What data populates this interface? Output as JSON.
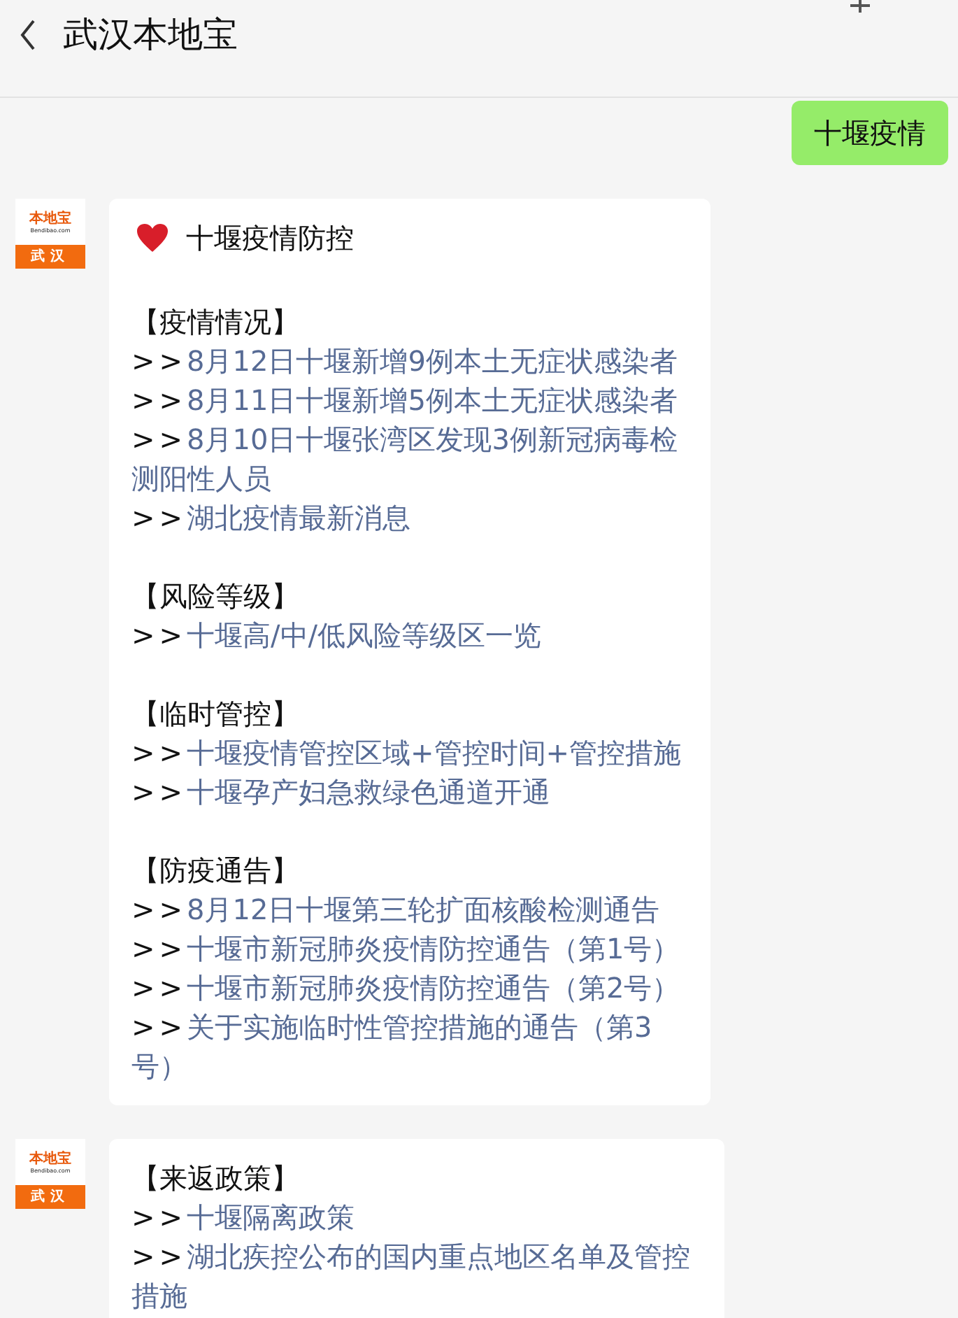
{
  "header": {
    "title": "武汉本地宝"
  },
  "messages": [
    {
      "kind": "sent",
      "text": "十堰疫情"
    },
    {
      "kind": "received",
      "avatar": {
        "brand": "本地宝",
        "site": "Bendibao.com",
        "city": "武汉"
      },
      "lines": [
        {
          "kind": "title",
          "text": "十堰疫情防控"
        },
        {
          "kind": "blank"
        },
        {
          "kind": "heading",
          "text": "【疫情情况】"
        },
        {
          "kind": "link",
          "prefix": ">>",
          "text": "8月12日十堰新增9例本土无症状感染者"
        },
        {
          "kind": "link",
          "prefix": ">>",
          "text": "8月11日十堰新增5例本土无症状感染者"
        },
        {
          "kind": "link",
          "prefix": ">>",
          "text": "8月10日十堰张湾区发现3例新冠病毒检测阳性人员"
        },
        {
          "kind": "link",
          "prefix": ">>",
          "text": "湖北疫情最新消息"
        },
        {
          "kind": "blank"
        },
        {
          "kind": "heading",
          "text": "【风险等级】"
        },
        {
          "kind": "link",
          "prefix": ">>",
          "text": "十堰高/中/低风险等级区一览"
        },
        {
          "kind": "blank"
        },
        {
          "kind": "heading",
          "text": "【临时管控】"
        },
        {
          "kind": "link",
          "prefix": ">>",
          "text": "十堰疫情管控区域+管控时间+管控措施"
        },
        {
          "kind": "link",
          "prefix": ">>",
          "text": "十堰孕产妇急救绿色通道开通"
        },
        {
          "kind": "blank"
        },
        {
          "kind": "heading",
          "text": "【防疫通告】"
        },
        {
          "kind": "link",
          "prefix": ">>",
          "text": "8月12日十堰第三轮扩面核酸检测通告"
        },
        {
          "kind": "link",
          "prefix": ">>",
          "text": "十堰市新冠肺炎疫情防控通告（第1号）"
        },
        {
          "kind": "link",
          "prefix": ">>",
          "text": "十堰市新冠肺炎疫情防控通告（第2号）"
        },
        {
          "kind": "link",
          "prefix": ">>",
          "text": "关于实施临时性管控措施的通告（第3号）"
        }
      ]
    },
    {
      "kind": "received",
      "avatar": {
        "brand": "本地宝",
        "site": "Bendibao.com",
        "city": "武汉"
      },
      "lines": [
        {
          "kind": "heading",
          "text": "【来返政策】"
        },
        {
          "kind": "link",
          "prefix": ">>",
          "text": "十堰隔离政策"
        },
        {
          "kind": "link",
          "prefix": ">>",
          "text": "湖北疾控公布的国内重点地区名单及管控措施"
        }
      ]
    }
  ]
}
